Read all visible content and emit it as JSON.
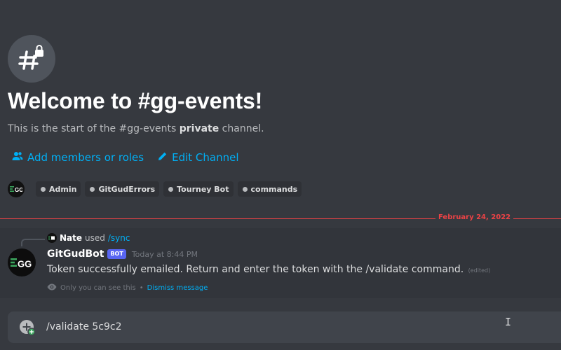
{
  "channel": {
    "icon": "hashtag-lock-icon",
    "welcome_title": "Welcome to #gg-events!",
    "subtitle_prefix": "This is the start of the #gg-events ",
    "subtitle_bold": "private",
    "subtitle_suffix": " channel."
  },
  "actions": {
    "add_members": "Add members or roles",
    "edit_channel": "Edit Channel"
  },
  "roles": [
    "Admin",
    "GitGudErrors",
    "Tourney Bot",
    "commands"
  ],
  "divider": {
    "date": "February 24, 2022",
    "color": "#ed4245"
  },
  "message": {
    "reply": {
      "name": "Nate",
      "used": "used",
      "command": "/sync"
    },
    "author": "GitGudBot",
    "bot_tag": "BOT",
    "timestamp": "Today at 8:44 PM",
    "text": "Token successfully emailed. Return and enter the token with the /validate command.",
    "edited": "(edited)",
    "ephemeral_note": "Only you can see this",
    "ephemeral_sep": "•",
    "dismiss": "Dismiss message"
  },
  "composer": {
    "value": "/validate 5c9c2",
    "cursor": "I"
  },
  "colors": {
    "accent_link": "#00aff4",
    "bot_tag": "#5865f2",
    "background": "#36393f"
  }
}
